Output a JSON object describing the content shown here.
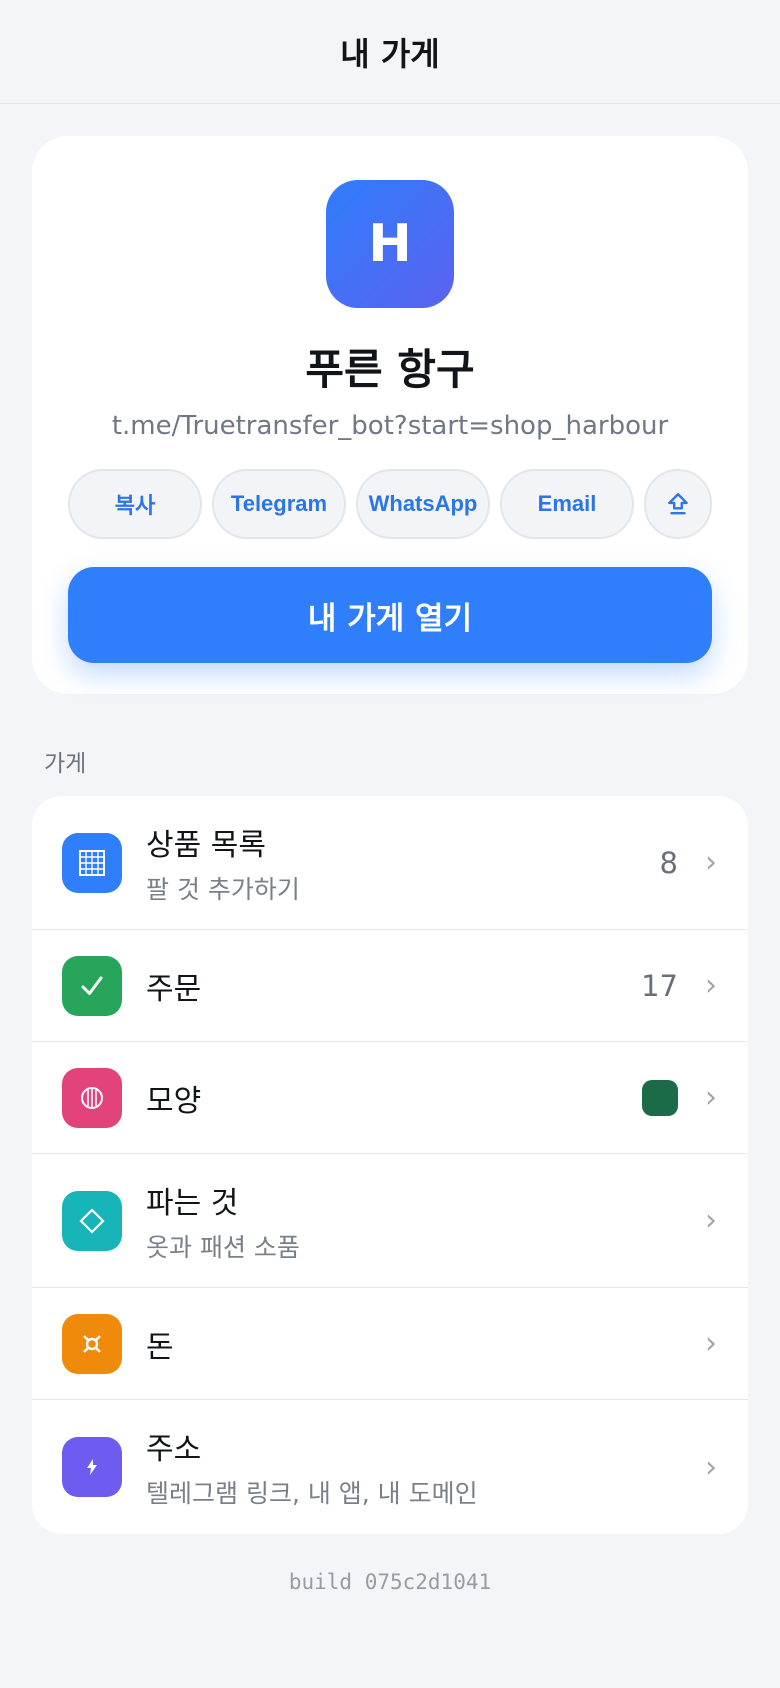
{
  "header": {
    "title": "내 가게"
  },
  "shop": {
    "logo_letter": "H",
    "name": "푸른 항구",
    "link": "t.me/Truetransfer_bot?start=shop_harbour",
    "share_buttons": [
      "복사",
      "Telegram",
      "WhatsApp",
      "Email"
    ],
    "share_icon": "share-upload-icon",
    "open_label": "내 가게 열기"
  },
  "section": {
    "label": "가게"
  },
  "menu": [
    {
      "title": "상품 목록",
      "subtitle": "팔 것 추가하기",
      "value": "8",
      "icon": "grid-icon",
      "color": "#2f7ffd"
    },
    {
      "title": "주문",
      "subtitle": "",
      "value": "17",
      "icon": "check-icon",
      "color": "#27a55a"
    },
    {
      "title": "모양",
      "subtitle": "",
      "value": "",
      "swatch": "#1c6b48",
      "icon": "palette-icon",
      "color": "#e2437a"
    },
    {
      "title": "파는 것",
      "subtitle": "옷과 패션 소품",
      "value": "",
      "icon": "diamond-icon",
      "color": "#17b5b8"
    },
    {
      "title": "돈",
      "subtitle": "",
      "value": "",
      "icon": "currency-icon",
      "color": "#ef8a0a"
    },
    {
      "title": "주소",
      "subtitle": "텔레그램 링크, 내 앱, 내 도메인",
      "value": "",
      "icon": "link-icon",
      "color": "#6e5cf0"
    }
  ],
  "footer": {
    "build": "build 075c2d1041"
  }
}
